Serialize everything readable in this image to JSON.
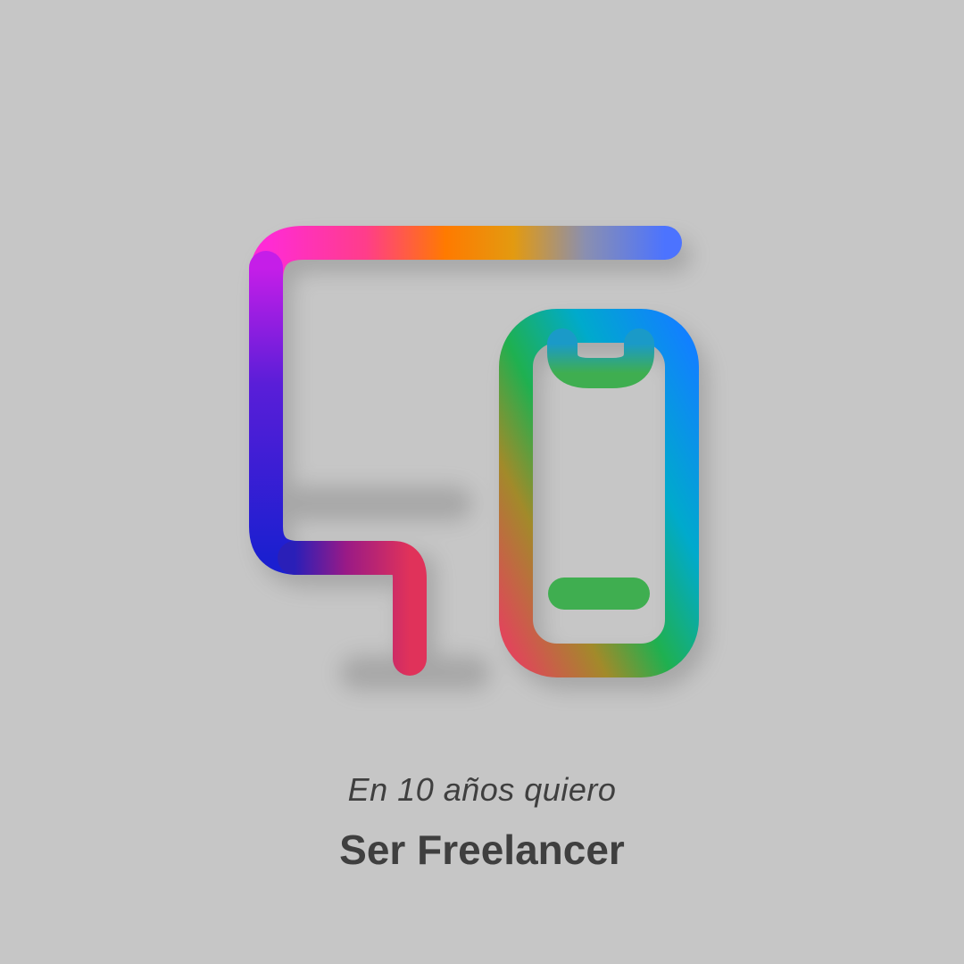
{
  "background_color": "#c6c6c6",
  "text_color": "#3f3f3f",
  "illustration": {
    "icon": "monitor-and-smartphone-icon",
    "gradient_colors": [
      "#ff2bd6",
      "#ff7a00",
      "#4c73ff",
      "#1b1fd0",
      "#e0205a",
      "#009cf0",
      "#00b050"
    ]
  },
  "caption": {
    "subtitle": "En 10 años quiero",
    "title": "Ser Freelancer"
  }
}
